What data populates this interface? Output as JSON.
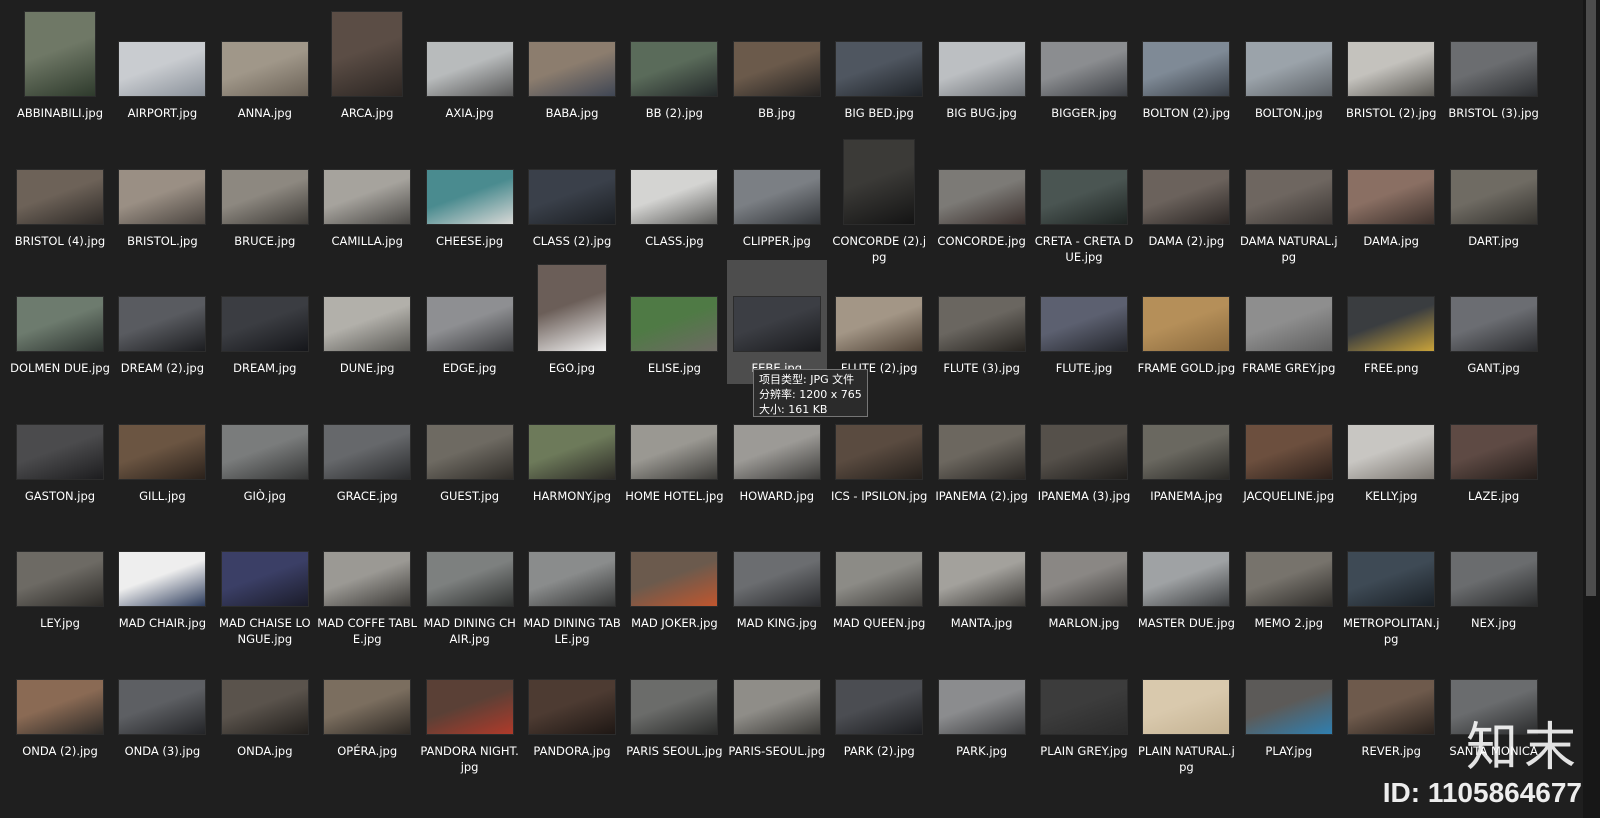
{
  "files": [
    {
      "name": "ABBINABILI.jpg",
      "c1": "#6f7866",
      "c2": "#2e3a2c",
      "shape": "portrait"
    },
    {
      "name": "AIRPORT.jpg",
      "c1": "#c9ccd0",
      "c2": "#8a919a"
    },
    {
      "name": "ANNA.jpg",
      "c1": "#a09789",
      "c2": "#6b6257"
    },
    {
      "name": "ARCA.jpg",
      "c1": "#5b4d45",
      "c2": "#2c2623",
      "shape": "portrait"
    },
    {
      "name": "AXIA.jpg",
      "c1": "#b8bbbc",
      "c2": "#575757"
    },
    {
      "name": "BABA.jpg",
      "c1": "#8c7d6e",
      "c2": "#3f4654"
    },
    {
      "name": "BB (2).jpg",
      "c1": "#5a6b5a",
      "c2": "#24292a"
    },
    {
      "name": "BB.jpg",
      "c1": "#6b5a4b",
      "c2": "#252322"
    },
    {
      "name": "BIG BED.jpg",
      "c1": "#4f5660",
      "c2": "#1f2328"
    },
    {
      "name": "BIG BUG.jpg",
      "c1": "#bcbfc2",
      "c2": "#6d7176"
    },
    {
      "name": "BIGGER.jpg",
      "c1": "#8b8d90",
      "c2": "#3c3f44"
    },
    {
      "name": "BOLTON (2).jpg",
      "c1": "#7f8a96",
      "c2": "#3a4048"
    },
    {
      "name": "BOLTON.jpg",
      "c1": "#9ba3aa",
      "c2": "#5c6166"
    },
    {
      "name": "BRISTOL (2).jpg",
      "c1": "#c4c2bd",
      "c2": "#5b5954"
    },
    {
      "name": "BRISTOL (3).jpg",
      "c1": "#6b6d70",
      "c2": "#2c2e31"
    },
    {
      "name": "BRISTOL (4).jpg",
      "c1": "#6d6258",
      "c2": "#2e2a27"
    },
    {
      "name": "BRISTOL.jpg",
      "c1": "#9a8f84",
      "c2": "#4b4540"
    },
    {
      "name": "BRUCE.jpg",
      "c1": "#8d8880",
      "c2": "#3e3b37"
    },
    {
      "name": "CAMILLA.jpg",
      "c1": "#a6a39d",
      "c2": "#4a4845"
    },
    {
      "name": "CHEESE.jpg",
      "c1": "#4a8b8f",
      "c2": "#d8d8d6"
    },
    {
      "name": "CLASS (2).jpg",
      "c1": "#3a404a",
      "c2": "#1b1e22"
    },
    {
      "name": "CLASS.jpg",
      "c1": "#d4d4d2",
      "c2": "#5c5c5a"
    },
    {
      "name": "CLIPPER.jpg",
      "c1": "#7b7f84",
      "c2": "#33363a"
    },
    {
      "name": "CONCORDE (2).jpg",
      "c1": "#3b3a37",
      "c2": "#141414",
      "shape": "portrait"
    },
    {
      "name": "CONCORDE.jpg",
      "c1": "#7c7a76",
      "c2": "#3a2f2c"
    },
    {
      "name": "CRETA - CRETA DUE.jpg",
      "c1": "#4a5552",
      "c2": "#1e2422"
    },
    {
      "name": "DAMA (2).jpg",
      "c1": "#6b625c",
      "c2": "#2b2624"
    },
    {
      "name": "DAMA NATURAL.jpg",
      "c1": "#6e6660",
      "c2": "#3b3633"
    },
    {
      "name": "DAMA.jpg",
      "c1": "#8a6f63",
      "c2": "#3d312c"
    },
    {
      "name": "DART.jpg",
      "c1": "#6f6b63",
      "c2": "#34322e"
    },
    {
      "name": "DOLMEN DUE.jpg",
      "c1": "#6d7b6e",
      "c2": "#2d3430"
    },
    {
      "name": "DREAM (2).jpg",
      "c1": "#595b60",
      "c2": "#1c1d20"
    },
    {
      "name": "DREAM.jpg",
      "c1": "#3b3d42",
      "c2": "#15161a"
    },
    {
      "name": "DUNE.jpg",
      "c1": "#b2b0aa",
      "c2": "#5a5955"
    },
    {
      "name": "EDGE.jpg",
      "c1": "#8e8f92",
      "c2": "#3b3c3f"
    },
    {
      "name": "EGO.jpg",
      "c1": "#6b5e58",
      "c2": "#f2f2f2",
      "shape": "tall"
    },
    {
      "name": "ELISE.jpg",
      "c1": "#4f7a45",
      "c2": "#6d6963"
    },
    {
      "name": "FEBE.jpg",
      "c1": "#3c3e44",
      "c2": "#1a1b1e"
    },
    {
      "name": "FLUTE (2).jpg",
      "c1": "#a39686",
      "c2": "#4f4236"
    },
    {
      "name": "FLUTE (3).jpg",
      "c1": "#6a6660",
      "c2": "#26231f"
    },
    {
      "name": "FLUTE.jpg",
      "c1": "#5c6070",
      "c2": "#24262c"
    },
    {
      "name": "FRAME GOLD.jpg",
      "c1": "#b58f59",
      "c2": "#8a6a3e"
    },
    {
      "name": "FRAME GREY.jpg",
      "c1": "#8e8e8e",
      "c2": "#5e5e5e"
    },
    {
      "name": "FREE.png",
      "c1": "#3a3d40",
      "c2": "#c9a33a"
    },
    {
      "name": "GANT.jpg",
      "c1": "#6b6d72",
      "c2": "#2a2b2e"
    },
    {
      "name": "GASTON.jpg",
      "c1": "#4b4b4d",
      "c2": "#1d1d1f"
    },
    {
      "name": "GILL.jpg",
      "c1": "#6b5542",
      "c2": "#2a211b"
    },
    {
      "name": "GIÒ.jpg",
      "c1": "#7a7c7c",
      "c2": "#353636"
    },
    {
      "name": "GRACE.jpg",
      "c1": "#66686b",
      "c2": "#2a2b2d"
    },
    {
      "name": "GUEST.jpg",
      "c1": "#6e6a62",
      "c2": "#2f2c28"
    },
    {
      "name": "HARMONY.jpg",
      "c1": "#6d7a5a",
      "c2": "#2c2a26"
    },
    {
      "name": "HOME HOTEL.jpg",
      "c1": "#9a9892",
      "c2": "#3c3b38"
    },
    {
      "name": "HOWARD.jpg",
      "c1": "#9c9a96",
      "c2": "#3d3c3a"
    },
    {
      "name": "ICS - IPSILON.jpg",
      "c1": "#5a4b40",
      "c2": "#25201c"
    },
    {
      "name": "IPANEMA (2).jpg",
      "c1": "#6c675f",
      "c2": "#2a2724"
    },
    {
      "name": "IPANEMA (3).jpg",
      "c1": "#55504a",
      "c2": "#201e1c"
    },
    {
      "name": "IPANEMA.jpg",
      "c1": "#6a6860",
      "c2": "#2a2926"
    },
    {
      "name": "JACQUELINE.jpg",
      "c1": "#6c4f3e",
      "c2": "#2c201b"
    },
    {
      "name": "KELLY.jpg",
      "c1": "#c8c6c2",
      "c2": "#7a756f"
    },
    {
      "name": "LAZE.jpg",
      "c1": "#5e4a44",
      "c2": "#241d1a"
    },
    {
      "name": "LEY.jpg",
      "c1": "#6d6a64",
      "c2": "#2c2a27"
    },
    {
      "name": "MAD CHAIR.jpg",
      "c1": "#eeeeee",
      "c2": "#2d3c5c"
    },
    {
      "name": "MAD CHAISE LONGUE.jpg",
      "c1": "#3b3f66",
      "c2": "#1b1c2a"
    },
    {
      "name": "MAD COFFE TABLE.jpg",
      "c1": "#9b9994",
      "c2": "#3c3a37"
    },
    {
      "name": "MAD DINING CHAIR.jpg",
      "c1": "#7d807f",
      "c2": "#2f3130"
    },
    {
      "name": "MAD DINING TABLE.jpg",
      "c1": "#8a8c8c",
      "c2": "#343535"
    },
    {
      "name": "MAD JOKER.jpg",
      "c1": "#6b5a4d",
      "c2": "#c0562e"
    },
    {
      "name": "MAD KING.jpg",
      "c1": "#6b6d70",
      "c2": "#2a2b2e"
    },
    {
      "name": "MAD QUEEN.jpg",
      "c1": "#8c8b86",
      "c2": "#3f3d3a"
    },
    {
      "name": "MANTA.jpg",
      "c1": "#a3a19c",
      "c2": "#3c3a37"
    },
    {
      "name": "MARLON.jpg",
      "c1": "#8a8784",
      "c2": "#3d3b39"
    },
    {
      "name": "MASTER DUE.jpg",
      "c1": "#9fa2a4",
      "c2": "#3d3f41"
    },
    {
      "name": "MEMO 2.jpg",
      "c1": "#77736c",
      "c2": "#2e2c29"
    },
    {
      "name": "METROPOLITAN.jpg",
      "c1": "#3e4a55",
      "c2": "#1a2026"
    },
    {
      "name": "NEX.jpg",
      "c1": "#6a6c6e",
      "c2": "#2a2b2c"
    },
    {
      "name": "ONDA (2).jpg",
      "c1": "#8a6a54",
      "c2": "#2d2a27"
    },
    {
      "name": "ONDA (3).jpg",
      "c1": "#5d5f63",
      "c2": "#232427"
    },
    {
      "name": "ONDA.jpg",
      "c1": "#5a534c",
      "c2": "#221f1c"
    },
    {
      "name": "OPÉRA.jpg",
      "c1": "#7b6e5f",
      "c2": "#2e2924"
    },
    {
      "name": "PANDORA NIGHT.jpg",
      "c1": "#5a4036",
      "c2": "#b03a2a"
    },
    {
      "name": "PANDORA.jpg",
      "c1": "#4d3b32",
      "c2": "#1e1714"
    },
    {
      "name": "PARIS SEOUL.jpg",
      "c1": "#6b6c6a",
      "c2": "#2a2b2a"
    },
    {
      "name": "PARIS-SEOUL.jpg",
      "c1": "#8f8d88",
      "c2": "#3a3936"
    },
    {
      "name": "PARK (2).jpg",
      "c1": "#4b4d52",
      "c2": "#1c1d20"
    },
    {
      "name": "PARK.jpg",
      "c1": "#8b8c8e",
      "c2": "#3b3c3e"
    },
    {
      "name": "PLAIN GREY.jpg",
      "c1": "#3c3c3c",
      "c2": "#2a2a2a"
    },
    {
      "name": "PLAIN NATURAL.jpg",
      "c1": "#d9c9ad",
      "c2": "#c4b292"
    },
    {
      "name": "PLAY.jpg",
      "c1": "#5c5a58",
      "c2": "#2f7fb0"
    },
    {
      "name": "REVER.jpg",
      "c1": "#6e5a4c",
      "c2": "#2a221d"
    },
    {
      "name": "SANTA MONICA",
      "c1": "#6a6c6e",
      "c2": "#2a2b2c"
    }
  ],
  "selected_index": 37,
  "tooltip": {
    "type": "项目类型: JPG 文件",
    "resolution": "分辨率: 1200 x 765",
    "size": "大小: 161 KB"
  },
  "watermark": {
    "brand": "知末",
    "id": "ID: 1105864677"
  }
}
